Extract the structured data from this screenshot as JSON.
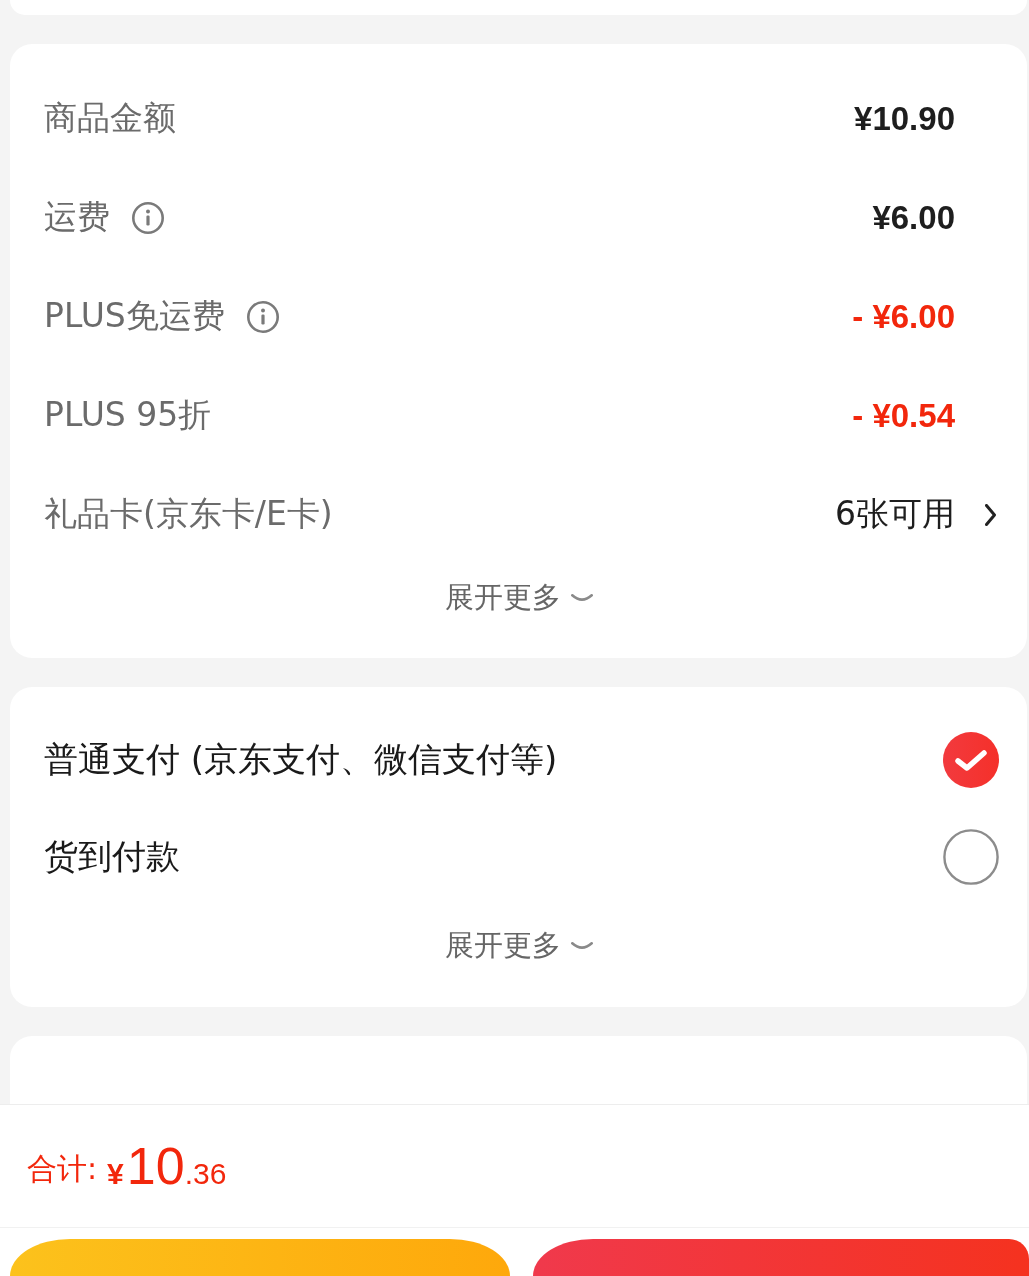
{
  "summary": {
    "rows": [
      {
        "label": "商品金额",
        "info": false,
        "kind": "amount",
        "value": "¥10.90"
      },
      {
        "label": "运费",
        "info": true,
        "kind": "amount",
        "value": "¥6.00"
      },
      {
        "label": "PLUS免运费",
        "info": true,
        "kind": "discount",
        "value": "- ¥6.00"
      },
      {
        "label": "PLUS 95折",
        "info": false,
        "kind": "discount",
        "value": "- ¥0.54"
      },
      {
        "label": "礼品卡(京东卡/E卡)",
        "info": false,
        "kind": "link",
        "value": "6张可用"
      }
    ],
    "expand": {
      "label": "展开更多"
    }
  },
  "payment": {
    "options": [
      {
        "label": "普通支付 (京东支付、微信支付等)",
        "selected": true
      },
      {
        "label": "货到付款",
        "selected": false
      }
    ],
    "expand": {
      "label": "展开更多"
    }
  },
  "footer": {
    "total_label": "合计:",
    "total": {
      "currency": "¥",
      "integer": "10",
      "decimal": ".36"
    },
    "buttons": [
      {
        "kind": "secondary"
      },
      {
        "kind": "primary"
      }
    ]
  }
}
